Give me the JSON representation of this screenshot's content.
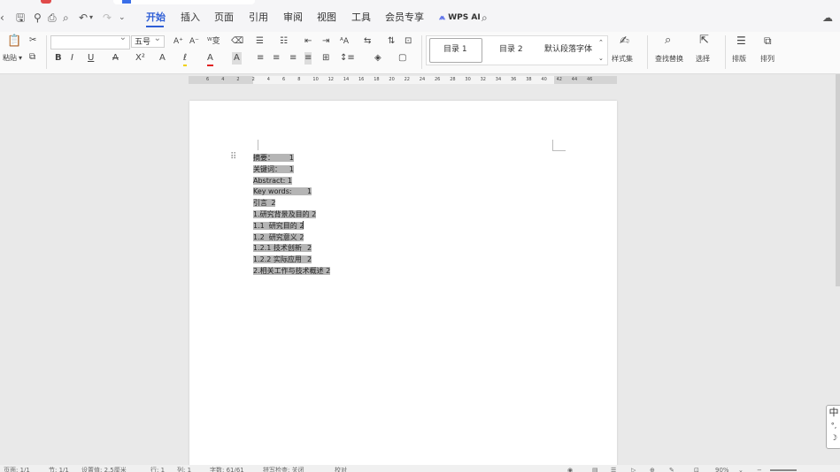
{
  "quick_access": {
    "icons": [
      "save-icon",
      "link-icon",
      "print-icon",
      "print-preview-icon",
      "undo-icon",
      "redo-icon",
      "more-icon"
    ]
  },
  "menu": {
    "tabs": [
      "开始",
      "插入",
      "页面",
      "引用",
      "审阅",
      "视图",
      "工具",
      "会员专享"
    ],
    "active": "开始",
    "wps_ai": "WPS AI"
  },
  "ribbon": {
    "paste_label": "粘贴",
    "font_size": "五号",
    "styles": [
      "目录 1",
      "目录 2",
      "默认段落字体"
    ],
    "style_set_label": "样式集",
    "find_replace_label": "查找替换",
    "select_label": "选择",
    "layout_label": "排版",
    "arrange_label": "排列"
  },
  "ruler": {
    "labels": [
      "6",
      "4",
      "2",
      "2",
      "4",
      "6",
      "8",
      "10",
      "12",
      "14",
      "16",
      "18",
      "20",
      "22",
      "24",
      "26",
      "28",
      "30",
      "32",
      "34",
      "36",
      "38",
      "40",
      "42",
      "44",
      "46"
    ]
  },
  "document": {
    "toc": [
      "摘要：\t1",
      "关键词：\t1",
      "Abstract: 1",
      "Key words:\t1",
      "引言\t2",
      "1.研究背景及目的 2",
      "1.1  研究目的 2",
      "1.2  研究意义 2",
      "1.2.1 技术创新\t2",
      "1.2.2 实际应用\t2",
      "2.相关工作与技术概述 2"
    ]
  },
  "ime": {
    "lang": "中",
    "dots": "°,",
    "moon": "☽"
  },
  "status": {
    "page": "页面: 1/1",
    "section": "节: 1/1",
    "setting": "设置值: 2.5厘米",
    "line": "行: 1",
    "column": "列: 1",
    "word_count": "字数: 61/61",
    "spellcheck": "拼写检查: 关闭",
    "proofread": "校对",
    "zoom": "90%"
  }
}
